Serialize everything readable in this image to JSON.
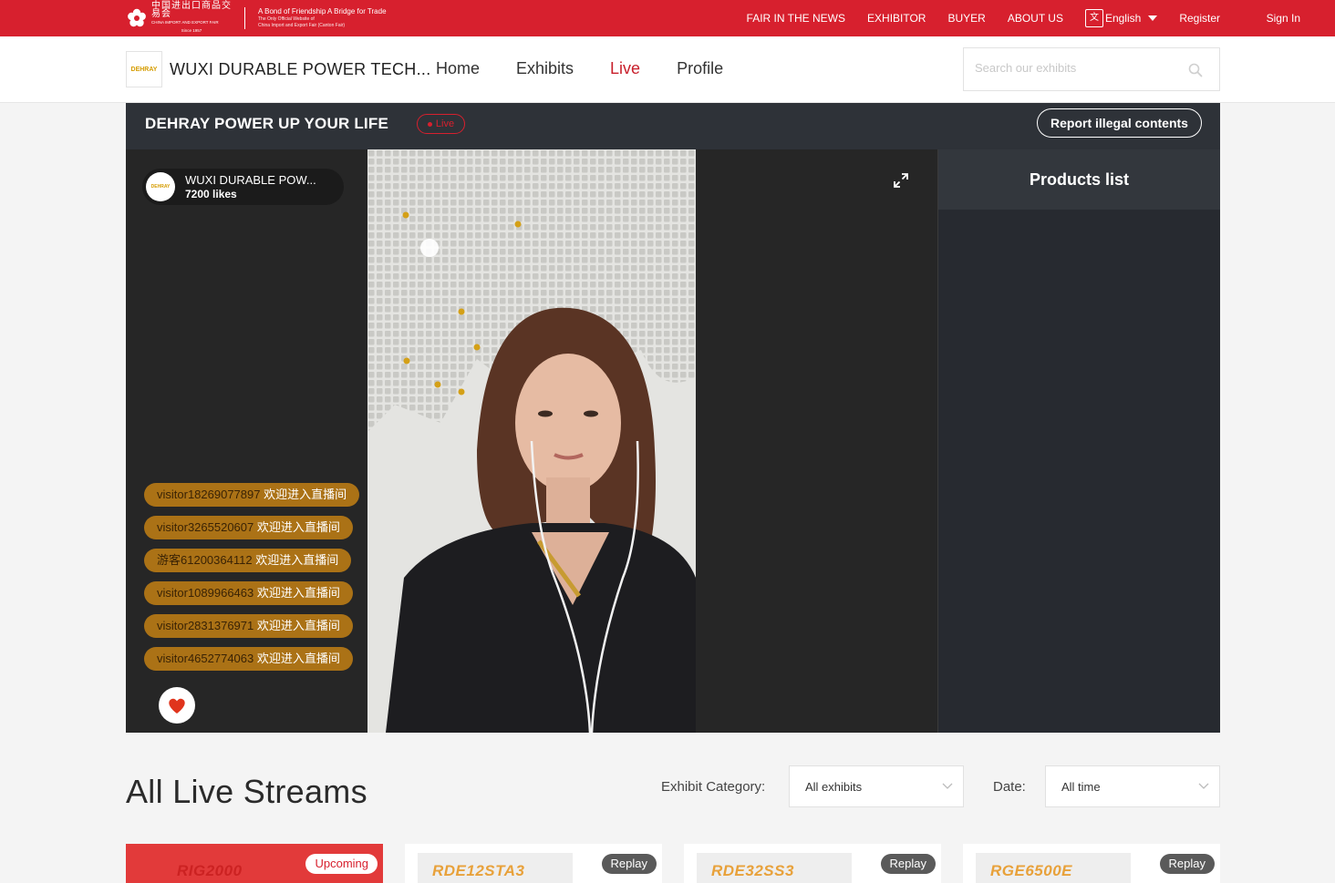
{
  "topbar": {
    "brand_cn": "中国进出口商品交易会",
    "brand_en": "CHINA IMPORT AND EXPORT FAIR",
    "brand_since": "Since 1957",
    "slogan": "A Bond of Friendship A Bridge for Trade",
    "slogan_sub1": "The Only Official Website of",
    "slogan_sub2": "China Import and Export Fair (Canton Fair)",
    "nav": [
      "FAIR IN THE NEWS",
      "EXHIBITOR",
      "BUYER",
      "ABOUT US"
    ],
    "language": "English",
    "register": "Register",
    "sign_in": "Sign In"
  },
  "header": {
    "company_logo_text": "DEHRAY",
    "company_name": "WUXI DURABLE POWER TECH...",
    "nav": {
      "home": "Home",
      "exhibits": "Exhibits",
      "live": "Live",
      "profile": "Profile"
    },
    "search_placeholder": "Search our exhibits"
  },
  "live": {
    "title": "DEHRAY POWER UP YOUR LIFE",
    "badge": "Live",
    "report_button": "Report illegal contents",
    "host_name": "WUXI DURABLE POW...",
    "host_avatar_text": "DEHRAY",
    "likes": "7200 likes",
    "chat": [
      {
        "user": "visitor18269077897",
        "message": "欢迎进入直播间"
      },
      {
        "user": "visitor3265520607",
        "message": "欢迎进入直播间"
      },
      {
        "user": "游客61200364112",
        "message": "欢迎进入直播间"
      },
      {
        "user": "visitor1089966463",
        "message": "欢迎进入直播间"
      },
      {
        "user": "visitor2831376971",
        "message": "欢迎进入直播间"
      },
      {
        "user": "visitor4652774063",
        "message": "欢迎进入直播间"
      }
    ],
    "products_title": "Products list"
  },
  "streams": {
    "title": "All Live Streams",
    "category_label": "Exhibit Category:",
    "category_value": "All exhibits",
    "date_label": "Date:",
    "date_value": "All time",
    "cards": [
      {
        "model": "RIG2000",
        "tag": "Upcoming"
      },
      {
        "model": "RDE12STA3",
        "tag": "Replay"
      },
      {
        "model": "RDE32SS3",
        "tag": "Replay"
      },
      {
        "model": "RGE6500E",
        "tag": "Replay"
      }
    ]
  },
  "colors": {
    "brand_red": "#d7202e",
    "active_nav": "#c81f2b",
    "chat_bubble": "#be7d14",
    "player_bg": "#262626"
  }
}
